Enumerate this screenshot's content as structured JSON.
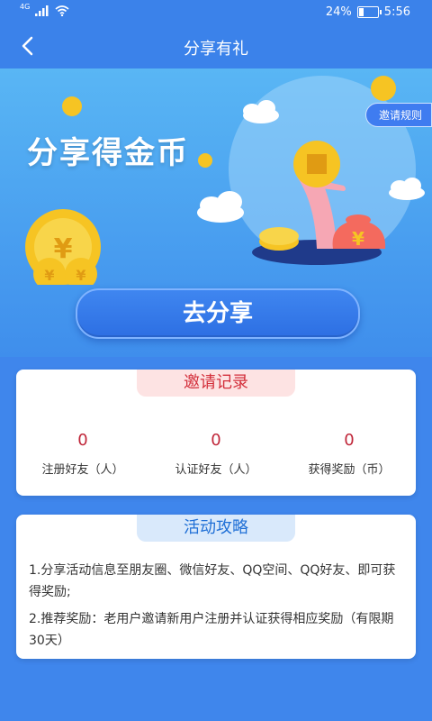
{
  "status_bar": {
    "network": "4G",
    "battery_percent": "24%",
    "battery_level": 0.24,
    "time": "5:56"
  },
  "nav": {
    "title": "分享有礼"
  },
  "hero": {
    "title": "分享得金币",
    "rules_button": "邀请规则",
    "share_button": "去分享",
    "coin_symbol": "¥"
  },
  "invite_records": {
    "title": "邀请记录",
    "stats": [
      {
        "value": "0",
        "label": "注册好友（人）"
      },
      {
        "value": "0",
        "label": "认证好友（人）"
      },
      {
        "value": "0",
        "label": "获得奖励（币）"
      }
    ]
  },
  "guide": {
    "title": "活动攻略",
    "items": [
      "1.分享活动信息至朋友圈、微信好友、QQ空间、QQ好友、即可获得奖励;",
      "2.推荐奖励：老用户邀请新用户注册并认证获得相应奖励（有限期30天）"
    ]
  },
  "colors": {
    "primary": "#3b82ea",
    "accent_red": "#c0273a",
    "gold": "#f6c423"
  }
}
